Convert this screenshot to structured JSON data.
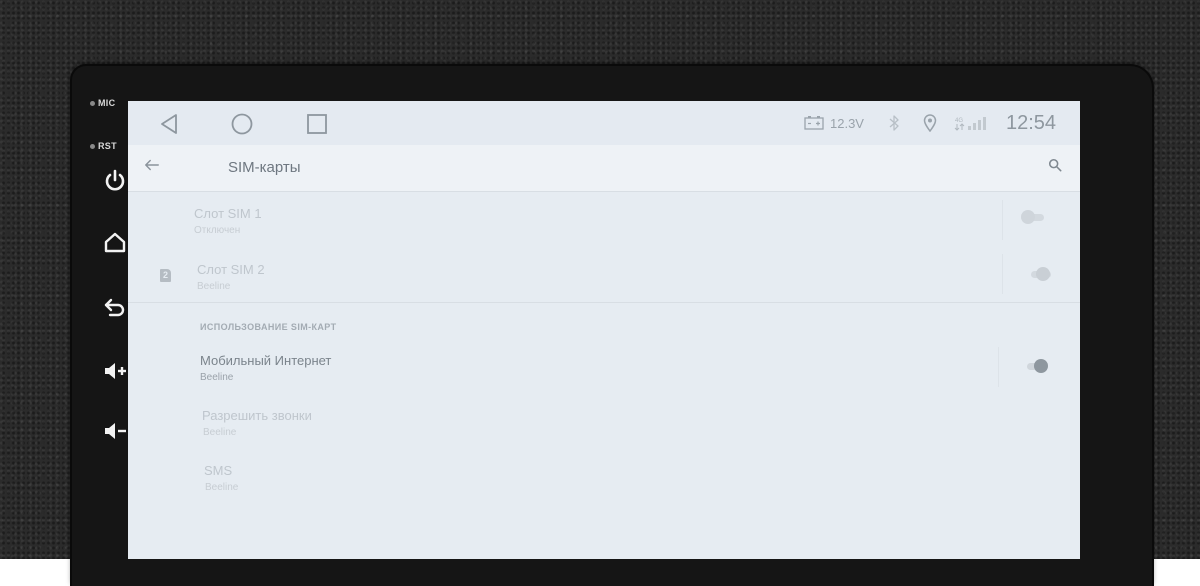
{
  "side_panel": {
    "mic_label": "MIC",
    "rst_label": "RST",
    "buttons": [
      "power-icon",
      "home-icon",
      "back-icon",
      "volume-up-icon",
      "volume-down-icon"
    ]
  },
  "statusbar": {
    "nav": [
      "back-triangle-icon",
      "home-circle-icon",
      "recents-square-icon"
    ],
    "voltage": "12.3V",
    "time": "12:54",
    "icons": [
      "battery-icon",
      "bluetooth-icon",
      "location-icon",
      "signal-icon"
    ]
  },
  "appbar": {
    "title": "SIM-карты"
  },
  "sim_slots": [
    {
      "title": "Слот SIM 1",
      "subtitle": "Отключен",
      "enabled": false
    },
    {
      "title": "Слот SIM 2",
      "subtitle": "Beeline",
      "enabled": false,
      "badge": "2"
    }
  ],
  "section_header": "ИСПОЛЬЗОВАНИЕ SIM-КАРТ",
  "usage": [
    {
      "title": "Мобильный Интернет",
      "subtitle": "Beeline",
      "enabled": true
    },
    {
      "title": "Разрешить звонки",
      "subtitle": "Beeline",
      "enabled": false
    },
    {
      "title": "SMS",
      "subtitle": "Beeline",
      "enabled": false
    }
  ],
  "colors": {
    "screen_bg": "#e6ecf2",
    "device_bezel": "#151515",
    "dim_text": "#bfc6cd",
    "active_text": "#7b848c"
  }
}
